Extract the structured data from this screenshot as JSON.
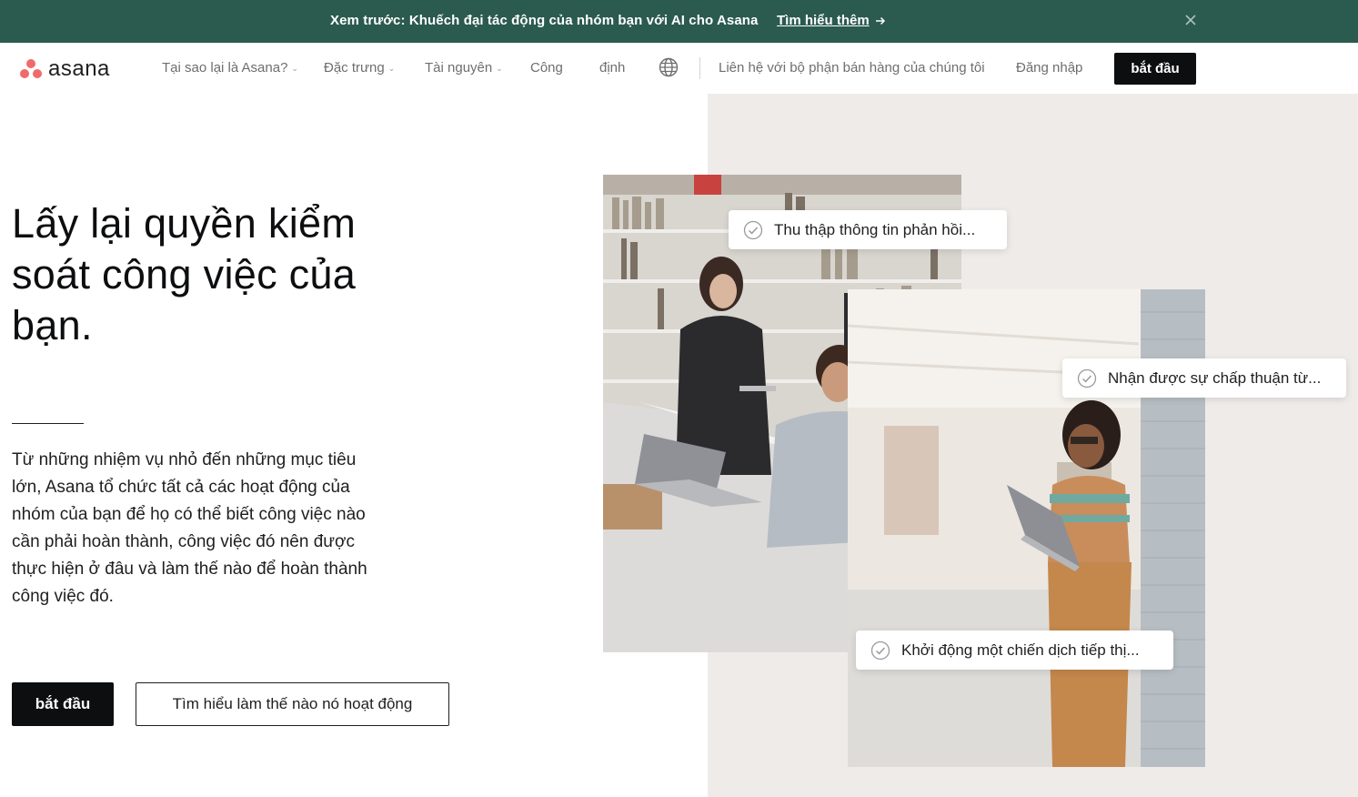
{
  "banner": {
    "text": "Xem trước: Khuếch đại tác động của nhóm bạn với AI cho Asana",
    "link": "Tìm hiểu thêm",
    "link_icon": "arrow-right-icon",
    "close_icon": "close-icon"
  },
  "nav": {
    "logo_text": "asana",
    "items": [
      {
        "label": "Tại sao lại là Asana?",
        "has_dropdown": true
      },
      {
        "label": "Đặc trưng",
        "has_dropdown": true
      },
      {
        "label": "Tài nguyên",
        "has_dropdown": true
      },
      {
        "label": "Công",
        "has_dropdown": false
      },
      {
        "label": "định",
        "has_dropdown": false
      }
    ],
    "globe_icon": "globe-icon",
    "contact_sales": "Liên hệ với bộ phận bán hàng của chúng tôi",
    "login": "Đăng nhập",
    "cta": "bắt đầu"
  },
  "hero": {
    "title": "Lấy lại quyền kiểm soát công việc của bạn.",
    "description": "Từ những nhiệm vụ nhỏ đến những mục tiêu lớn, Asana tổ chức tất cả các hoạt động của nhóm của bạn để họ có thể biết công việc nào cần phải hoàn thành, công việc đó nên được thực hiện ở đâu và làm thế nào để hoàn thành công việc đó.",
    "primary_button": "bắt đầu",
    "secondary_button": "Tìm hiểu làm thế nào nó hoạt động"
  },
  "tasks": [
    {
      "label": "Thu thập thông tin phản hồi..."
    },
    {
      "label": "Nhận được sự chấp thuận từ..."
    },
    {
      "label": "Khởi động một chiến dịch tiếp thị..."
    }
  ],
  "colors": {
    "banner_bg": "#2b5a4e",
    "brand_coral": "#f06a6a",
    "cta_bg": "#0d0e10",
    "panel_bg": "#efebe9"
  }
}
